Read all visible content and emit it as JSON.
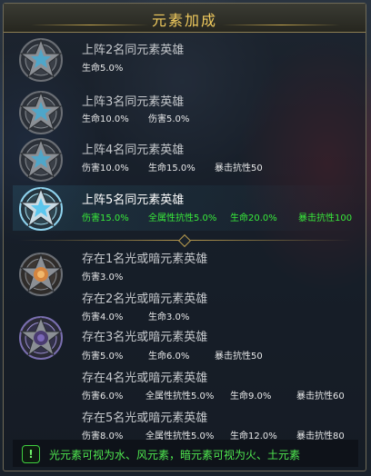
{
  "title": "元素加成",
  "rows": [
    {
      "title": "上阵2名同元素英雄",
      "stats": [
        "生命5.0%"
      ]
    },
    {
      "title": "上阵3名同元素英雄",
      "stats": [
        "生命10.0%",
        "伤害5.0%"
      ]
    },
    {
      "title": "上阵4名同元素英雄",
      "stats": [
        "伤害10.0%",
        "生命15.0%",
        "暴击抗性50"
      ]
    },
    {
      "title": "上阵5名同元素英雄",
      "stats": [
        "伤害15.0%",
        "全属性抗性5.0%",
        "生命20.0%",
        "暴击抗性100"
      ],
      "active": true
    },
    {
      "title": "存在1名光或暗元素英雄",
      "stats": [
        "伤害3.0%"
      ]
    },
    {
      "title": "存在2名光或暗元素英雄",
      "stats": [
        "伤害4.0%",
        "生命3.0%"
      ]
    },
    {
      "title": "存在3名光或暗元素英雄",
      "stats": [
        "伤害5.0%",
        "生命6.0%",
        "暴击抗性50"
      ]
    },
    {
      "title": "存在4名光或暗元素英雄",
      "stats": [
        "伤害6.0%",
        "全属性抗性5.0%",
        "生命9.0%",
        "暴击抗性60"
      ]
    },
    {
      "title": "存在5名光或暗元素英雄",
      "stats": [
        "伤害8.0%",
        "全属性抗性5.0%",
        "生命12.0%",
        "暴击抗性80"
      ]
    }
  ],
  "footer": {
    "icon": "!",
    "text": "光元素可视为水、风元素，暗元素可视为火、土元素"
  },
  "colors": {
    "title_gold": "#f2cc5e",
    "active_green": "#38ea3a",
    "footer_green": "#4fe74f"
  }
}
